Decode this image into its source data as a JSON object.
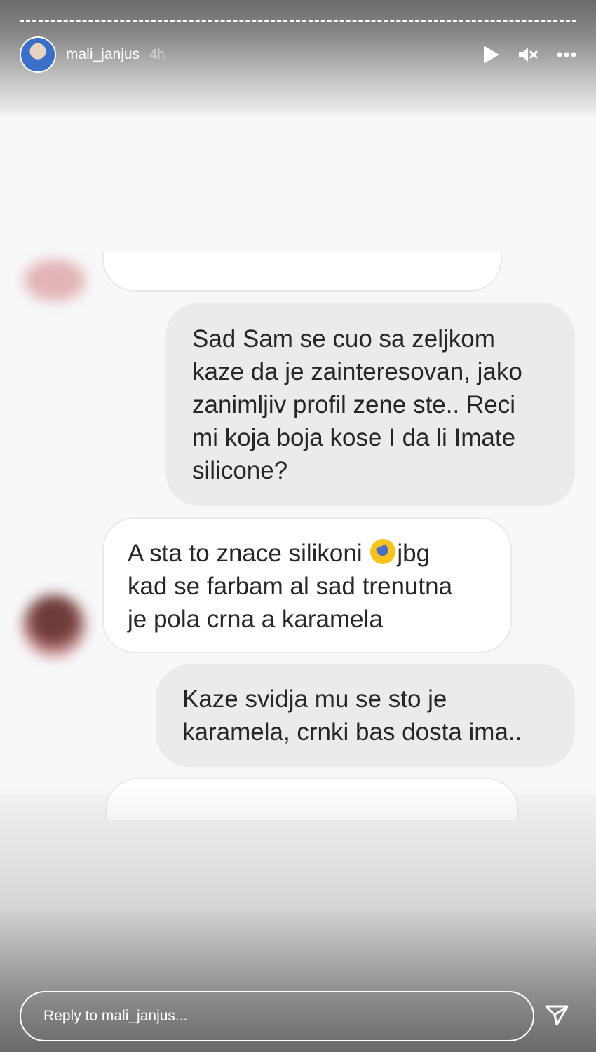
{
  "header": {
    "username": "mali_janjus",
    "time": "4h",
    "icons": [
      "play-icon",
      "mute-icon",
      "more-icon"
    ]
  },
  "messages": [
    {
      "from": "them",
      "lines": [
        ""
      ],
      "partial": true
    },
    {
      "from": "me",
      "lines": [
        "Sad Sam se cuo sa zeljkom",
        "kaze da je zainteresovan, jako",
        "zanimljiv profil zene ste.. Reci",
        "mi koja boja kose I da li Imate",
        "silicone?"
      ]
    },
    {
      "from": "them",
      "lines": [
        "A sta to znace silikoni",
        "jbg",
        "kad se farbam al sad trenutna",
        "je pola crna a karamela"
      ]
    },
    {
      "from": "me",
      "lines": [
        "Kaze svidja mu se sto je",
        "karamela, crnki bas dosta ima.."
      ]
    }
  ],
  "reply": {
    "placeholder": "Reply to mali_janjus..."
  },
  "colors": {
    "bubble_out": "#ebebeb",
    "bubble_in": "#ffffff",
    "text": "#262626"
  }
}
